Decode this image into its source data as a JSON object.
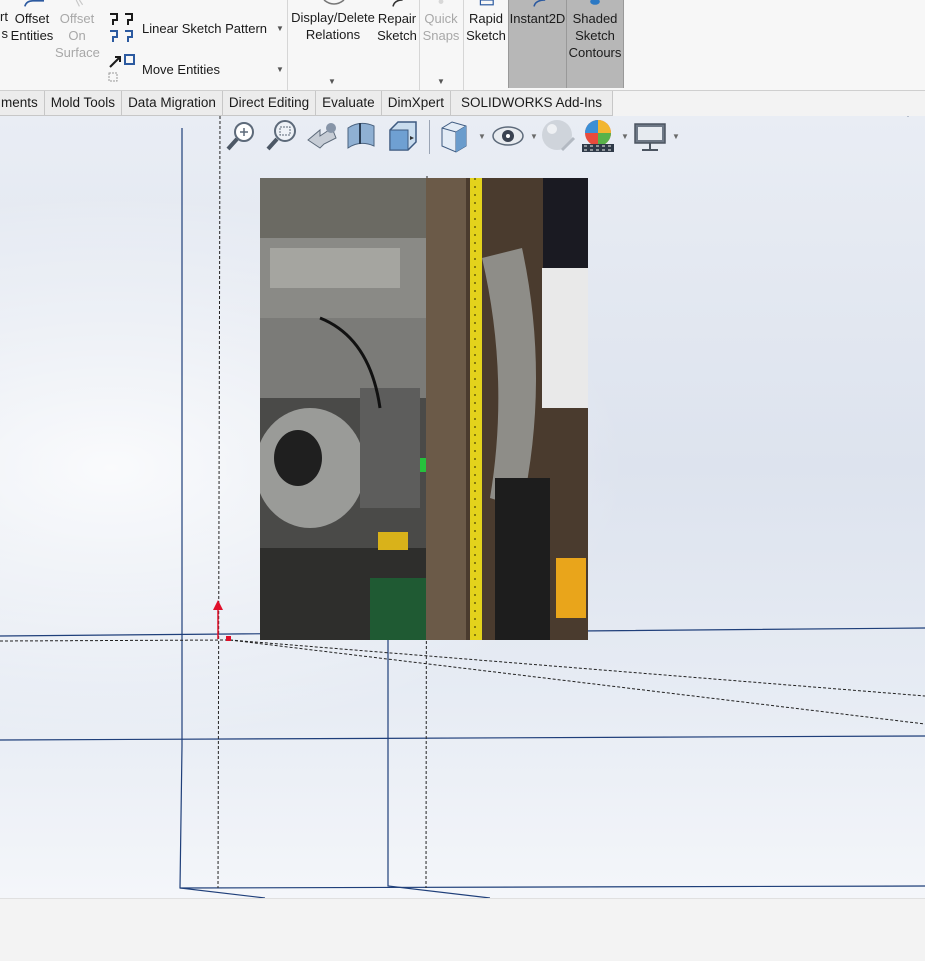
{
  "ribbon": {
    "convert_label": "rt\ns",
    "offset_entities_label": "Offset\nEntities",
    "offset_on_surface_label": "Offset\nOn\nSurface",
    "linear_sketch_pattern_label": "Linear Sketch Pattern",
    "move_entities_label": "Move Entities",
    "display_delete_relations_label": "Display/Delete\nRelations",
    "repair_sketch_label": "Repair\nSketch",
    "quick_snaps_label": "Quick\nSnaps",
    "rapid_sketch_label": "Rapid\nSketch",
    "instant2d_label": "Instant2D",
    "shaded_sketch_contours_label": "Shaded\nSketch\nContours"
  },
  "tabs": [
    {
      "label": "ments"
    },
    {
      "label": "Mold Tools"
    },
    {
      "label": "Data Migration"
    },
    {
      "label": "Direct Editing"
    },
    {
      "label": "Evaluate"
    },
    {
      "label": "DimXpert"
    },
    {
      "label": "SOLIDWORKS Add-Ins"
    }
  ],
  "heads_up_toolbar": {
    "icons": [
      "zoom-to-fit-icon",
      "zoom-to-area-icon",
      "previous-view-icon",
      "section-view-icon",
      "view-orientation-icon",
      "display-style-icon",
      "hide-show-items-icon",
      "edit-appearance-icon",
      "apply-scene-icon",
      "view-settings-icon"
    ]
  },
  "colors": {
    "accent_blue": "#1f4e9c",
    "active_tool_bg": "#b7b7b7",
    "origin_red": "#e0102a",
    "tape_yellow": "#e3d21c"
  }
}
